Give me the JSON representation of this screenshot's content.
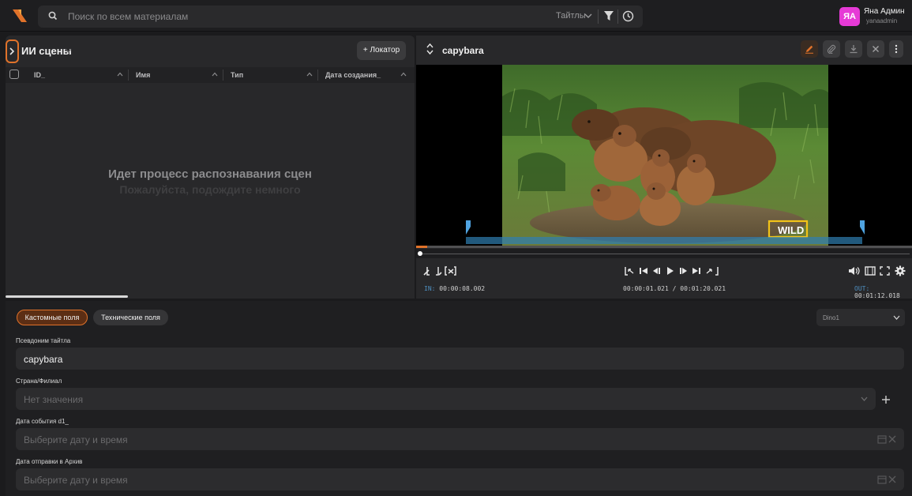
{
  "topbar": {
    "search_placeholder": "Поиск по всем материалам",
    "titles_filter": "Тайтлы",
    "user": {
      "initials": "ЯА",
      "name": "Яна Админ",
      "login": "yanaadmin"
    }
  },
  "left_panel": {
    "title": "ИИ сцены",
    "locator_button": "+ Локатор",
    "columns": [
      "ID_",
      "Имя",
      "Тип",
      "Дата создания_"
    ],
    "empty_title": "Идет процесс распознавания сцен",
    "empty_subtitle": "Пожалуйста, подождите немного"
  },
  "right_panel": {
    "title": "capybara",
    "in_label": "IN:",
    "in_time": "00:00:08.002",
    "position": "00:00:01.021 / 00:01:20.021",
    "out_label": "OUT:",
    "out_time": "00:01:12.018",
    "watermark": "WILD"
  },
  "bottom": {
    "tabs": [
      "Кастомные поля",
      "Технические поля"
    ],
    "preset": "Dino1",
    "fields": [
      {
        "label": "Псевдоним тайтла",
        "value": "capybara"
      },
      {
        "label": "Страна/Филиал",
        "placeholder": "Нет значения"
      },
      {
        "label": "Дата события d1_",
        "placeholder": "Выберите дату и время"
      },
      {
        "label": "Дата отправки в Архив",
        "placeholder": "Выберите дату и время"
      }
    ]
  },
  "colors": {
    "accent": "#e0722a",
    "avatar": "#e63ad6",
    "timecode_label": "#4f8fc0"
  }
}
